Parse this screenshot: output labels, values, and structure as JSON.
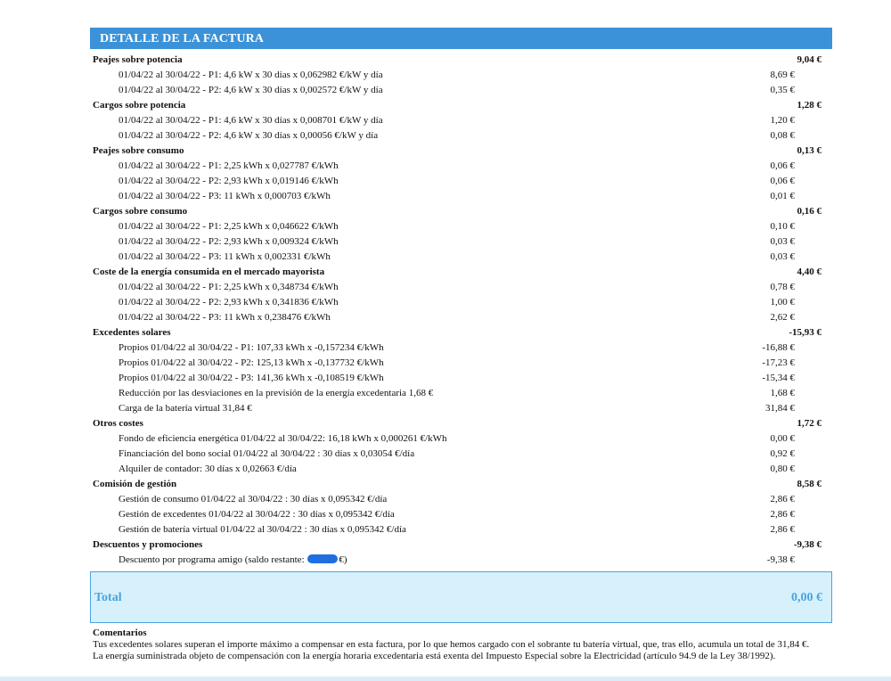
{
  "header": {
    "title": "DETALLE DE LA FACTURA"
  },
  "rows": [
    {
      "type": "section",
      "label": "Peajes sobre potencia",
      "amount": "9,04 €"
    },
    {
      "type": "item",
      "label": "01/04/22 al 30/04/22 - P1: 4,6 kW x 30 días x 0,062982 €/kW y día",
      "amount": "8,69 €"
    },
    {
      "type": "item",
      "label": "01/04/22 al 30/04/22 - P2: 4,6 kW x 30 días x 0,002572 €/kW y día",
      "amount": "0,35 €"
    },
    {
      "type": "section",
      "label": "Cargos sobre potencia",
      "amount": "1,28 €"
    },
    {
      "type": "item",
      "label": "01/04/22 al 30/04/22 - P1: 4,6 kW x 30 días x 0,008701 €/kW y día",
      "amount": "1,20 €"
    },
    {
      "type": "item",
      "label": "01/04/22 al 30/04/22 - P2: 4,6 kW x 30 días x 0,00056 €/kW y día",
      "amount": "0,08 €"
    },
    {
      "type": "section",
      "label": "Peajes sobre consumo",
      "amount": "0,13 €"
    },
    {
      "type": "item",
      "label": "01/04/22 al 30/04/22 - P1: 2,25 kWh x 0,027787 €/kWh",
      "amount": "0,06 €"
    },
    {
      "type": "item",
      "label": "01/04/22 al 30/04/22 - P2: 2,93 kWh x 0,019146 €/kWh",
      "amount": "0,06 €"
    },
    {
      "type": "item",
      "label": "01/04/22 al 30/04/22 - P3: 11 kWh x 0,000703 €/kWh",
      "amount": "0,01 €"
    },
    {
      "type": "section",
      "label": "Cargos sobre consumo",
      "amount": "0,16 €"
    },
    {
      "type": "item",
      "label": "01/04/22 al 30/04/22 - P1: 2,25 kWh x 0,046622 €/kWh",
      "amount": "0,10 €"
    },
    {
      "type": "item",
      "label": "01/04/22 al 30/04/22 - P2: 2,93 kWh x 0,009324 €/kWh",
      "amount": "0,03 €"
    },
    {
      "type": "item",
      "label": "01/04/22 al 30/04/22 - P3: 11 kWh x 0,002331 €/kWh",
      "amount": "0,03 €"
    },
    {
      "type": "section",
      "label": "Coste de la energía consumida en el mercado mayorista",
      "amount": "4,40 €"
    },
    {
      "type": "item",
      "label": "01/04/22 al 30/04/22 - P1: 2,25 kWh x 0,348734 €/kWh",
      "amount": "0,78 €"
    },
    {
      "type": "item",
      "label": "01/04/22 al 30/04/22 - P2: 2,93 kWh x 0,341836 €/kWh",
      "amount": "1,00 €"
    },
    {
      "type": "item",
      "label": "01/04/22 al 30/04/22 - P3: 11 kWh x 0,238476 €/kWh",
      "amount": "2,62 €"
    },
    {
      "type": "section",
      "label": "Excedentes solares",
      "amount": "-15,93 €"
    },
    {
      "type": "item",
      "label": "Propios 01/04/22 al 30/04/22 - P1: 107,33 kWh x -0,157234 €/kWh",
      "amount": "-16,88 €"
    },
    {
      "type": "item",
      "label": "Propios 01/04/22 al 30/04/22 - P2: 125,13 kWh x -0,137732 €/kWh",
      "amount": "-17,23 €"
    },
    {
      "type": "item",
      "label": "Propios 01/04/22 al 30/04/22 - P3: 141,36 kWh x -0,108519 €/kWh",
      "amount": "-15,34 €"
    },
    {
      "type": "item",
      "label": "Reducción por las desviaciones en la previsión de la energía excedentaria 1,68 €",
      "amount": "1,68 €"
    },
    {
      "type": "item",
      "label": "Carga de la batería virtual 31,84 €",
      "amount": "31,84 €"
    },
    {
      "type": "section",
      "label": "Otros costes",
      "amount": "1,72 €"
    },
    {
      "type": "item",
      "label": "Fondo de eficiencia energética 01/04/22 al 30/04/22: 16,18 kWh x 0,000261 €/kWh",
      "amount": "0,00 €"
    },
    {
      "type": "item",
      "label": "Financiación del bono social 01/04/22 al 30/04/22 : 30 días x 0,03054 €/día",
      "amount": "0,92 €"
    },
    {
      "type": "item",
      "label": "Alquiler de contador: 30 días x 0,02663 €/día",
      "amount": "0,80 €"
    },
    {
      "type": "section",
      "label": "Comisión de gestión",
      "amount": "8,58 €"
    },
    {
      "type": "item",
      "label": "Gestión de consumo 01/04/22 al 30/04/22 : 30 días x 0,095342 €/día",
      "amount": "2,86 €"
    },
    {
      "type": "item",
      "label": "Gestión de excedentes 01/04/22 al 30/04/22 : 30 días x 0,095342 €/día",
      "amount": "2,86 €"
    },
    {
      "type": "item",
      "label": "Gestión de batería virtual 01/04/22 al 30/04/22 : 30 días x 0,095342 €/día",
      "amount": "2,86 €"
    },
    {
      "type": "section",
      "label": "Descuentos y promociones",
      "amount": "-9,38 €"
    },
    {
      "type": "item",
      "label": "Descuento por programa amigo (saldo restante: ",
      "label_suffix": "€)",
      "redacted": true,
      "amount": "-9,38 €"
    }
  ],
  "total": {
    "label": "Total",
    "amount": "0,00 €"
  },
  "comments": {
    "title": "Comentarios",
    "text": "Tus excedentes solares superan el importe máximo a compensar en esta factura, por lo que hemos cargado con el sobrante tu batería virtual, que, tras ello, acumula un total de 31,84 €. La energía suministrada objeto de compensación con la energía horaria excedentaria está exenta del Impuesto Especial sobre la Electricidad (artículo 94.9 de la Ley 38/1992)."
  },
  "colors": {
    "header_bg": "#3b92d8",
    "total_bg": "#d6f1fb",
    "total_text": "#4aa3e0",
    "redaction": "#1f6fe0"
  }
}
